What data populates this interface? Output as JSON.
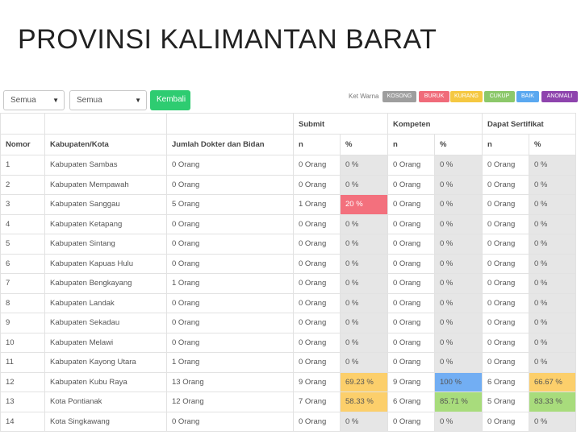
{
  "page_title": "PROVINSI KALIMANTAN BARAT",
  "filters": {
    "select1_value": "Semua",
    "select2_value": "Semua",
    "back_button": "Kembali"
  },
  "legend": {
    "label": "Ket Warna",
    "items": [
      {
        "label": "KOSONG",
        "color": "#9e9e9e"
      },
      {
        "label": "BURUK",
        "color": "#f06b7a"
      },
      {
        "label": "KURANG",
        "color": "#f5c842"
      },
      {
        "label": "CUKUP",
        "color": "#8cc86a"
      },
      {
        "label": "BAIK",
        "color": "#5aa8f0"
      },
      {
        "label": "ANOMALI",
        "color": "#8e44ad"
      }
    ]
  },
  "table": {
    "groups": {
      "submit": "Submit",
      "kompeten": "Kompeten",
      "sertifikat": "Dapat Sertifikat"
    },
    "columns": {
      "nomor": "Nomor",
      "kabupaten": "Kabupaten/Kota",
      "jumlah": "Jumlah Dokter dan Bidan",
      "n": "n",
      "pct": "%"
    },
    "rows": [
      {
        "no": "1",
        "kab": "Kabupaten Sambas",
        "jml": "0 Orang",
        "sn": "0 Orang",
        "sp": "0 %",
        "kn": "0 Orang",
        "kp": "0 %",
        "dn": "0 Orang",
        "dp": "0 %",
        "sc": "pct",
        "kc": "pct",
        "dc": "pct"
      },
      {
        "no": "2",
        "kab": "Kabupaten Mempawah",
        "jml": "0 Orang",
        "sn": "0 Orang",
        "sp": "0 %",
        "kn": "0 Orang",
        "kp": "0 %",
        "dn": "0 Orang",
        "dp": "0 %",
        "sc": "pct",
        "kc": "pct",
        "dc": "pct"
      },
      {
        "no": "3",
        "kab": "Kabupaten Sanggau",
        "jml": "5 Orang",
        "sn": "1 Orang",
        "sp": "20 %",
        "kn": "0 Orang",
        "kp": "0 %",
        "dn": "0 Orang",
        "dp": "0 %",
        "sc": "red",
        "kc": "pct",
        "dc": "pct"
      },
      {
        "no": "4",
        "kab": "Kabupaten Ketapang",
        "jml": "0 Orang",
        "sn": "0 Orang",
        "sp": "0 %",
        "kn": "0 Orang",
        "kp": "0 %",
        "dn": "0 Orang",
        "dp": "0 %",
        "sc": "pct",
        "kc": "pct",
        "dc": "pct"
      },
      {
        "no": "5",
        "kab": "Kabupaten Sintang",
        "jml": "0 Orang",
        "sn": "0 Orang",
        "sp": "0 %",
        "kn": "0 Orang",
        "kp": "0 %",
        "dn": "0 Orang",
        "dp": "0 %",
        "sc": "pct",
        "kc": "pct",
        "dc": "pct"
      },
      {
        "no": "6",
        "kab": "Kabupaten Kapuas Hulu",
        "jml": "0 Orang",
        "sn": "0 Orang",
        "sp": "0 %",
        "kn": "0 Orang",
        "kp": "0 %",
        "dn": "0 Orang",
        "dp": "0 %",
        "sc": "pct",
        "kc": "pct",
        "dc": "pct"
      },
      {
        "no": "7",
        "kab": "Kabupaten Bengkayang",
        "jml": "1 Orang",
        "sn": "0 Orang",
        "sp": "0 %",
        "kn": "0 Orang",
        "kp": "0 %",
        "dn": "0 Orang",
        "dp": "0 %",
        "sc": "pct",
        "kc": "pct",
        "dc": "pct"
      },
      {
        "no": "8",
        "kab": "Kabupaten Landak",
        "jml": "0 Orang",
        "sn": "0 Orang",
        "sp": "0 %",
        "kn": "0 Orang",
        "kp": "0 %",
        "dn": "0 Orang",
        "dp": "0 %",
        "sc": "pct",
        "kc": "pct",
        "dc": "pct"
      },
      {
        "no": "9",
        "kab": "Kabupaten Sekadau",
        "jml": "0 Orang",
        "sn": "0 Orang",
        "sp": "0 %",
        "kn": "0 Orang",
        "kp": "0 %",
        "dn": "0 Orang",
        "dp": "0 %",
        "sc": "pct",
        "kc": "pct",
        "dc": "pct"
      },
      {
        "no": "10",
        "kab": "Kabupaten Melawi",
        "jml": "0 Orang",
        "sn": "0 Orang",
        "sp": "0 %",
        "kn": "0 Orang",
        "kp": "0 %",
        "dn": "0 Orang",
        "dp": "0 %",
        "sc": "pct",
        "kc": "pct",
        "dc": "pct"
      },
      {
        "no": "11",
        "kab": "Kabupaten Kayong Utara",
        "jml": "1 Orang",
        "sn": "0 Orang",
        "sp": "0 %",
        "kn": "0 Orang",
        "kp": "0 %",
        "dn": "0 Orang",
        "dp": "0 %",
        "sc": "pct",
        "kc": "pct",
        "dc": "pct"
      },
      {
        "no": "12",
        "kab": "Kabupaten Kubu Raya",
        "jml": "13 Orang",
        "sn": "9 Orang",
        "sp": "69.23 %",
        "kn": "9 Orang",
        "kp": "100 %",
        "dn": "6 Orang",
        "dp": "66.67 %",
        "sc": "yellow",
        "kc": "blue",
        "dc": "yellow"
      },
      {
        "no": "13",
        "kab": "Kota Pontianak",
        "jml": "12 Orang",
        "sn": "7 Orang",
        "sp": "58.33 %",
        "kn": "6 Orang",
        "kp": "85.71 %",
        "dn": "5 Orang",
        "dp": "83.33 %",
        "sc": "yellow",
        "kc": "green",
        "dc": "green"
      },
      {
        "no": "14",
        "kab": "Kota Singkawang",
        "jml": "0 Orang",
        "sn": "0 Orang",
        "sp": "0 %",
        "kn": "0 Orang",
        "kp": "0 %",
        "dn": "0 Orang",
        "dp": "0 %",
        "sc": "pct",
        "kc": "pct",
        "dc": "pct"
      }
    ]
  }
}
